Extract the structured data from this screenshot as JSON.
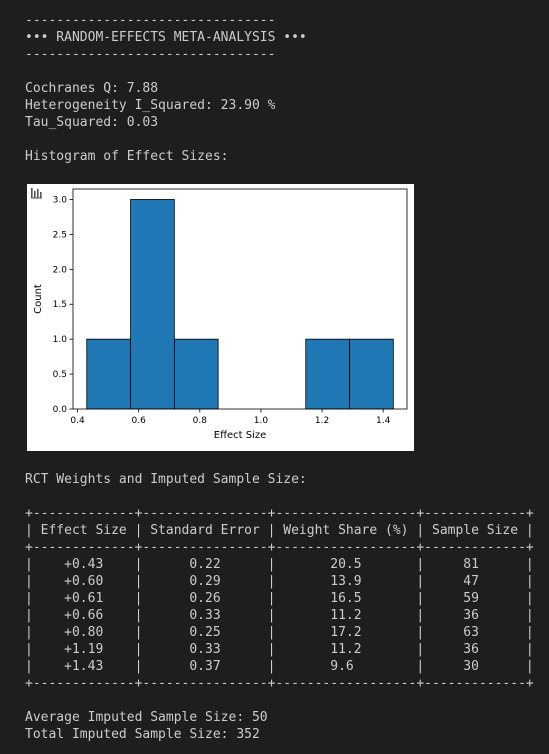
{
  "output": {
    "divider": "--------------------------------",
    "heading": "••• RANDOM-EFFECTS META-ANALYSIS •••",
    "cochranes_q": "Cochranes Q: 7.88",
    "i_squared": "Heterogeneity I_Squared: 23.90 %",
    "tau_squared": "Tau_Squared: 0.03",
    "histogram_heading": "Histogram of Effect Sizes:",
    "table_heading": "RCT Weights and Imputed Sample Size:",
    "average_line": "Average Imputed Sample Size: 50",
    "total_line": "Total Imputed Sample Size: 352"
  },
  "chart_data": {
    "type": "bar",
    "title": "",
    "xlabel": "Effect Size",
    "ylabel": "Count",
    "bin_edges": [
      0.43,
      0.5733,
      0.7167,
      0.86,
      1.0033,
      1.1467,
      1.29,
      1.4333
    ],
    "values": [
      1,
      3,
      1,
      0,
      0,
      1,
      1
    ],
    "xlim": [
      0.385,
      1.478
    ],
    "ylim": [
      0,
      3.15
    ],
    "x_ticks": [
      0.4,
      0.6,
      0.8,
      1.0,
      1.2,
      1.4
    ],
    "x_tick_labels": [
      "0.4",
      "0.6",
      "0.8",
      "1.0",
      "1.2",
      "1.4"
    ],
    "y_ticks": [
      0,
      0.5,
      1.0,
      1.5,
      2.0,
      2.5,
      3.0
    ],
    "y_tick_labels": [
      "0.0",
      "0.5",
      "1.0",
      "1.5",
      "2.0",
      "2.5",
      "3.0"
    ],
    "bar_color": "#1f77b4",
    "grid": false
  },
  "table": {
    "border": "+-------------+----------------+------------------+-------------+",
    "header": "| Effect Size | Standard Error | Weight Share (%) | Sample Size |",
    "rows": [
      "|    +0.43    |      0.22      |       20.5       |     81      |",
      "|    +0.60    |      0.29      |       13.9       |     47      |",
      "|    +0.61    |      0.26      |       16.5       |     59      |",
      "|    +0.66    |      0.33      |       11.2       |     36      |",
      "|    +0.80    |      0.25      |       17.2       |     63      |",
      "|    +1.19    |      0.33      |       11.2       |     36      |",
      "|    +1.43    |      0.37      |       9.6        |     30      |"
    ]
  }
}
